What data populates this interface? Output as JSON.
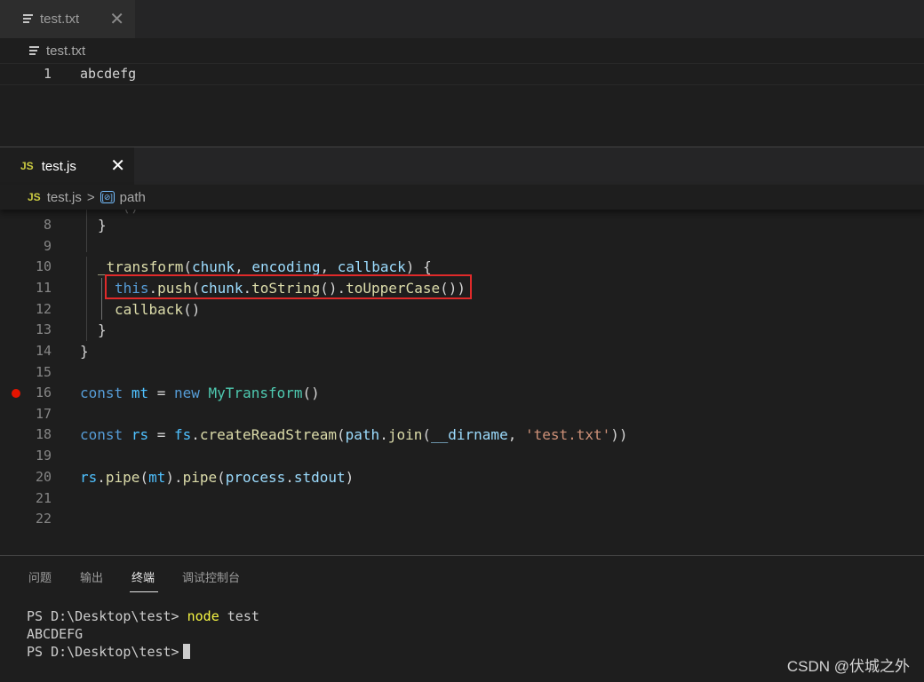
{
  "top_editor": {
    "tab_label": "test.txt",
    "tab_close": "✕",
    "breadcrumb": "test.txt",
    "line_number": "1",
    "line_text": "abcdefg"
  },
  "bottom_editor": {
    "tab_badge": "JS",
    "tab_label": "test.js",
    "tab_close": "✕",
    "breadcrumb_badge": "JS",
    "breadcrumb_file": "test.js",
    "breadcrumb_sep": ">",
    "breadcrumb_symbol_icon": "[⊘]",
    "breadcrumb_symbol": "path",
    "lines": {
      "n8": "8",
      "n9": "9",
      "n10": "10",
      "n11": "11",
      "n12": "12",
      "n13": "13",
      "n14": "14",
      "n15": "15",
      "n16": "16",
      "n17": "17",
      "n18": "18",
      "n19": "19",
      "n20": "20",
      "n21": "21",
      "n22": "22"
    },
    "code": {
      "l8": "}",
      "l10_fn": "_transform",
      "l10_p1": "chunk",
      "l10_p2": "encoding",
      "l10_p3": "callback",
      "l11_this": "this",
      "l11_push": "push",
      "l11_chunk": "chunk",
      "l11_tostring": "toString",
      "l11_upper": "toUpperCase",
      "l12_cb": "callback",
      "l13": "}",
      "l14": "}",
      "l16_const": "const",
      "l16_var": "mt",
      "l16_new": "new",
      "l16_cls": "MyTransform",
      "l18_const": "const",
      "l18_var": "rs",
      "l18_fs": "fs",
      "l18_fn": "createReadStream",
      "l18_path": "path",
      "l18_join": "join",
      "l18_dir": "__dirname",
      "l18_str": "'test.txt'",
      "l20_rs": "rs",
      "l20_pipe1": "pipe",
      "l20_mt": "mt",
      "l20_pipe2": "pipe",
      "l20_process": "process",
      "l20_stdout": "stdout"
    }
  },
  "panel": {
    "tabs": [
      "问题",
      "输出",
      "终端",
      "调试控制台"
    ],
    "active_tab": "终端",
    "terminal": {
      "prompt1": "PS D:\\Desktop\\test> ",
      "cmd": "node",
      "arg": " test",
      "output": "ABCDEFG",
      "prompt2": "PS D:\\Desktop\\test>"
    }
  },
  "watermark": "CSDN @伏城之外",
  "colors": {
    "keyword": "#569cd6",
    "function": "#dcdcaa",
    "variable": "#9cdcfe",
    "constant": "#4fc1ff",
    "string": "#ce9178",
    "class": "#4ec9b0",
    "highlight_box": "#e02a2a",
    "breakpoint": "#e51400"
  }
}
